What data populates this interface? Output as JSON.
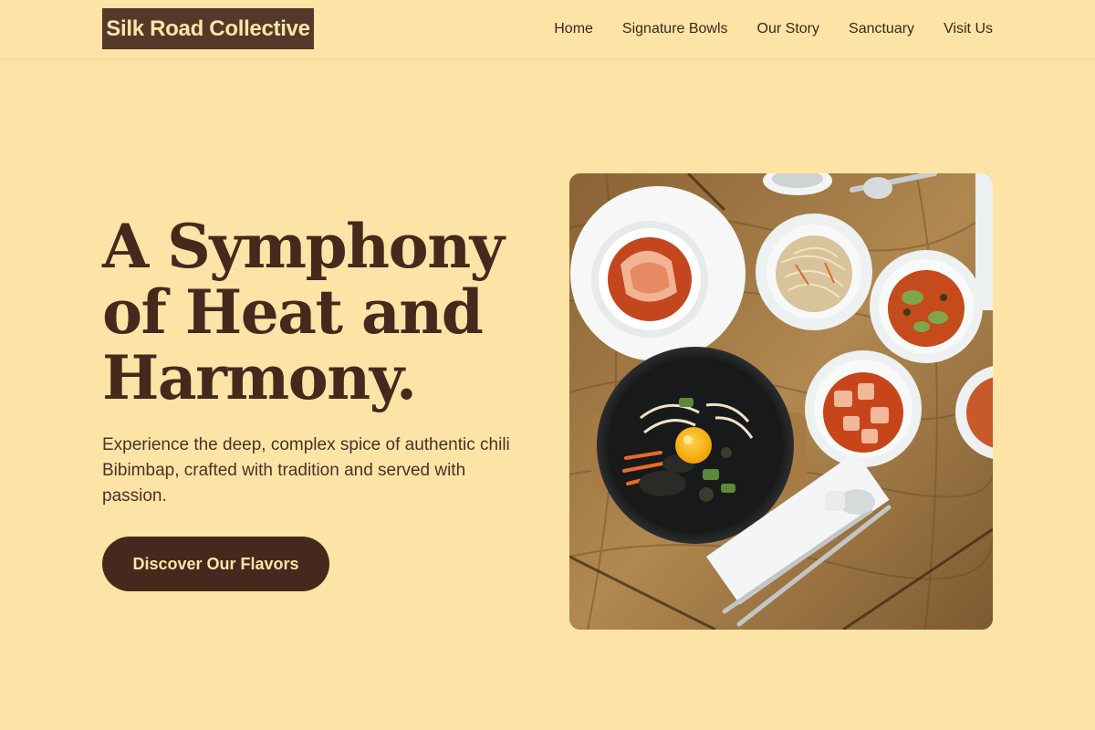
{
  "brand": {
    "name": "Silk Road Collective"
  },
  "nav": {
    "items": [
      {
        "label": "Home"
      },
      {
        "label": "Signature Bowls"
      },
      {
        "label": "Our Story"
      },
      {
        "label": "Sanctuary"
      },
      {
        "label": "Visit Us"
      }
    ]
  },
  "hero": {
    "title_lines": [
      "A Symphony",
      "of Heat and",
      "Harmony."
    ],
    "description": "Experience the deep, complex spice of authentic chili Bibimbap, crafted with tradition and served with passion.",
    "cta_label": "Discover Our Flavors",
    "image_icon": "bibimbap-photo"
  },
  "colors": {
    "background": "#fde4a6",
    "brand_dark": "#45291d",
    "logo_bg": "#54392b",
    "text_light": "#fde4a6"
  }
}
